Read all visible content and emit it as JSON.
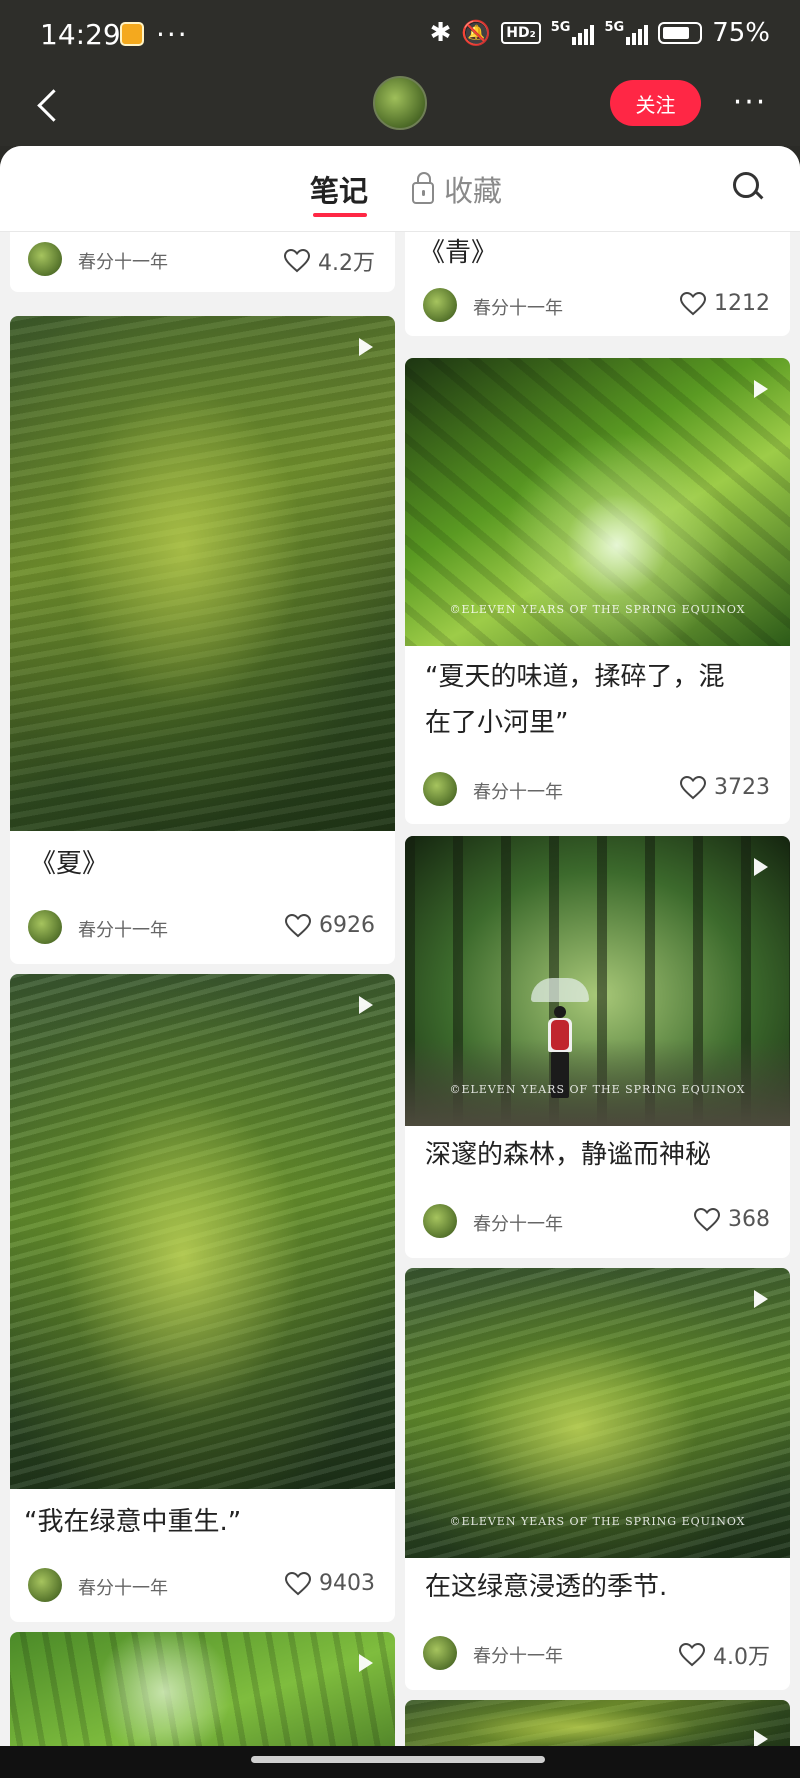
{
  "status_bar": {
    "time": "14:29",
    "more": "···",
    "hd_badge": "HD₂",
    "sig1_label": "5G",
    "sig2_label": "5G",
    "battery_percent": "75%",
    "battery_level": 0.75
  },
  "header": {
    "follow_label": "关注",
    "more_label": "···"
  },
  "tabs": {
    "notes": "笔记",
    "favorites": "收藏"
  },
  "author": "春分十一年",
  "left_column": [
    {
      "title": "",
      "likes": "4.2万",
      "image": "partial"
    },
    {
      "title": "《夏》",
      "likes": "6926",
      "image": "water"
    },
    {
      "title": "“我在绿意中重生.”",
      "likes": "9403",
      "image": "water2"
    },
    {
      "title": "",
      "likes": "",
      "image": "trees"
    }
  ],
  "right_column": [
    {
      "title": "《青》",
      "likes": "1212"
    },
    {
      "title_line1": "“夏天的味道，揉碎了，混",
      "title_line2": "在了小河里”",
      "likes": "3723",
      "watermark": "©ELEVEN YEARS OF THE SPRING EQUINOX"
    },
    {
      "title": "深邃的森林，静谧而神秘",
      "likes": "368",
      "watermark": "©ELEVEN YEARS OF THE SPRING EQUINOX"
    },
    {
      "title": "在这绿意浸透的季节.",
      "likes": "4.0万",
      "watermark": "©ELEVEN YEARS OF THE SPRING EQUINOX"
    }
  ],
  "icons": {
    "back": "chevron-left-icon",
    "search": "search-icon",
    "lock": "lock-icon",
    "like": "heart-icon",
    "play": "play-icon"
  },
  "colors": {
    "accent": "#ff2745",
    "header_bg": "#2e2e2a",
    "feed_bg": "#f2f2f2"
  }
}
